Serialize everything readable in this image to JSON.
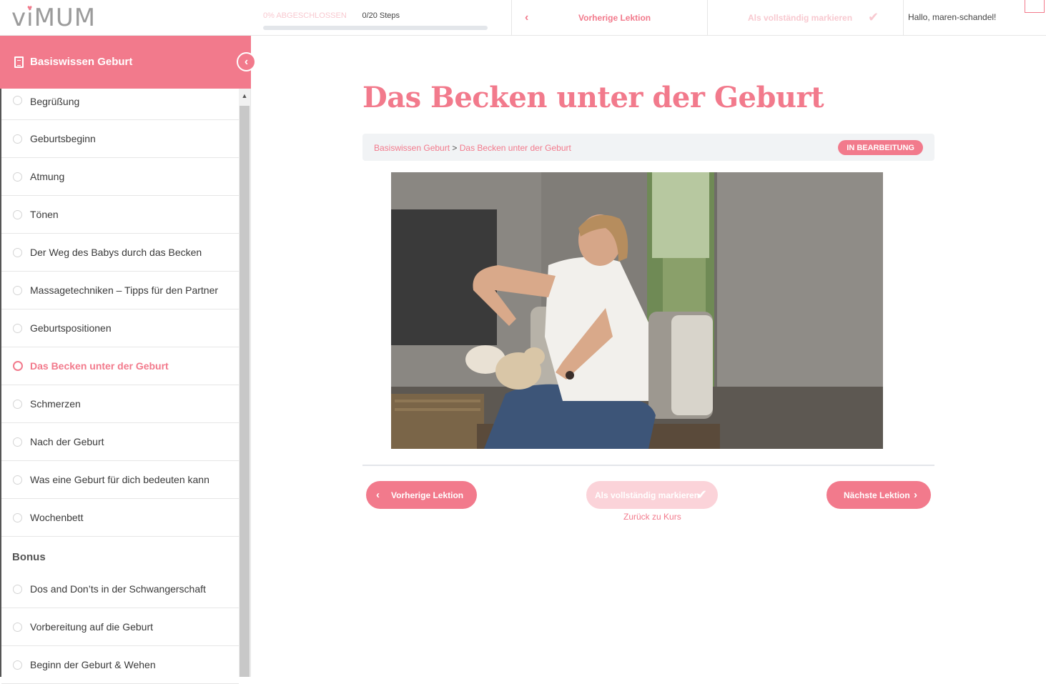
{
  "brand": {
    "logo_text": "viMUM"
  },
  "topbar": {
    "progress_label": "0% ABGESCHLOSSEN",
    "progress_steps": "0/20 Steps",
    "progress_fraction": 0,
    "prev_label": "Vorherige Lektion",
    "complete_label": "Als vollständig markieren",
    "greeting": "Hallo, maren-schandel!"
  },
  "sidebar": {
    "title": "Basiswissen Geburt",
    "items": [
      {
        "label": "Begrüßung"
      },
      {
        "label": "Geburtsbeginn"
      },
      {
        "label": "Atmung"
      },
      {
        "label": "Tönen"
      },
      {
        "label": "Der Weg des Babys durch das Becken"
      },
      {
        "label": "Massagetechniken – Tipps für den Partner"
      },
      {
        "label": "Geburtspositionen"
      },
      {
        "label": "Das Becken unter der Geburt"
      },
      {
        "label": "Schmerzen"
      },
      {
        "label": "Nach der Geburt"
      },
      {
        "label": "Was eine Geburt für dich bedeuten kann"
      },
      {
        "label": "Wochenbett"
      }
    ],
    "bonus_heading": "Bonus",
    "bonus_items": [
      {
        "label": "Dos and Don’ts in der Schwangerschaft"
      },
      {
        "label": "Vorbereitung auf die Geburt"
      },
      {
        "label": "Beginn der Geburt & Wehen"
      }
    ]
  },
  "main": {
    "title": "Das Becken unter der Geburt",
    "breadcrumb": {
      "course": "Basiswissen Geburt",
      "separator": ">",
      "lesson": "Das Becken unter der Geburt"
    },
    "status": "IN BEARBEITUNG",
    "buttons": {
      "prev": "Vorherige Lektion",
      "complete": "Als vollständig markieren",
      "next": "Nächste Lektion",
      "back": "Zurück zu Kurs"
    }
  },
  "colors": {
    "accent": "#f27a8c",
    "accent_light": "#fbd3d9",
    "bar_bg": "#f1f3f5"
  }
}
